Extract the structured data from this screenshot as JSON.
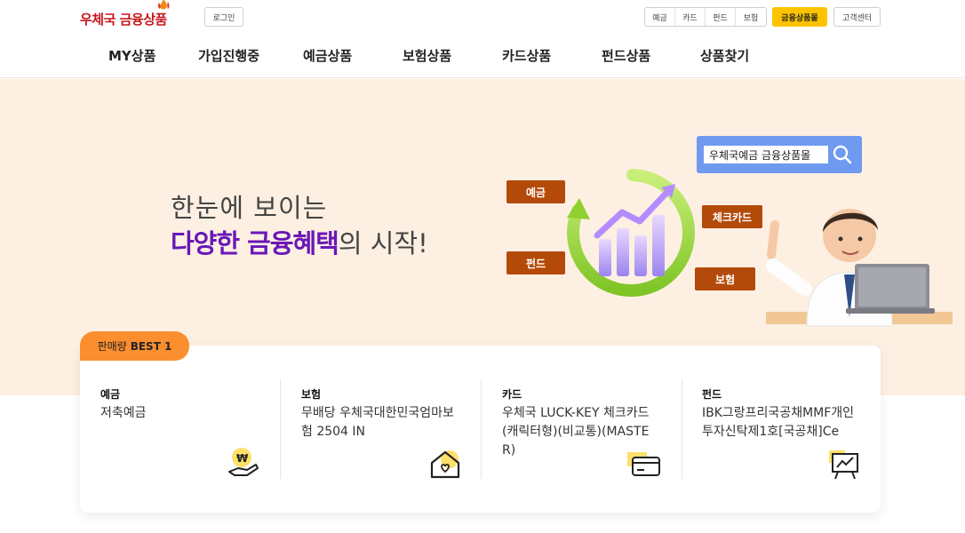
{
  "header": {
    "logo_text": "우체국 금융상품",
    "login_label": "로그인",
    "utility_links": [
      "예금",
      "카드",
      "펀드",
      "보험"
    ],
    "mall_label": "금융상품몰",
    "cs_label": "고객센터"
  },
  "gnb": {
    "items": [
      "MY상품",
      "가입진행중",
      "예금상품",
      "보험상품",
      "카드상품",
      "펀드상품",
      "상품찾기"
    ]
  },
  "hero": {
    "line1": "한눈에 보이는",
    "line2_emph": "다양한 금융혜택",
    "line2_rest": "의 시작!",
    "search_value": "우체국예금 금융상품몰",
    "tags": {
      "deposit": "예금",
      "fund": "펀드",
      "checkcard": "체크카드",
      "insurance": "보험"
    }
  },
  "best": {
    "badge_prefix": "판매량",
    "badge_strong": "BEST 1",
    "items": [
      {
        "category": "예금",
        "name": "저축예금",
        "icon": "money-hand-icon"
      },
      {
        "category": "보험",
        "name": "무배당 우체국대한민국엄마보험 2504 IN",
        "icon": "house-heart-icon"
      },
      {
        "category": "카드",
        "name": "우체국 LUCK-KEY 체크카드(캐릭터형)(비교통)(MASTER)",
        "icon": "card-icon"
      },
      {
        "category": "펀드",
        "name": "IBK그랑프리국공채MMF개인투자신탁제1호[국공채]Ce",
        "icon": "chart-board-icon"
      }
    ]
  },
  "colors": {
    "brand_red": "#c8161d",
    "accent_yellow": "#fdc300",
    "hero_bg": "#fdf0e2",
    "emph_purple": "#6a17b8",
    "tag_brown": "#b44a09",
    "badge_orange": "#fb8e2e"
  }
}
